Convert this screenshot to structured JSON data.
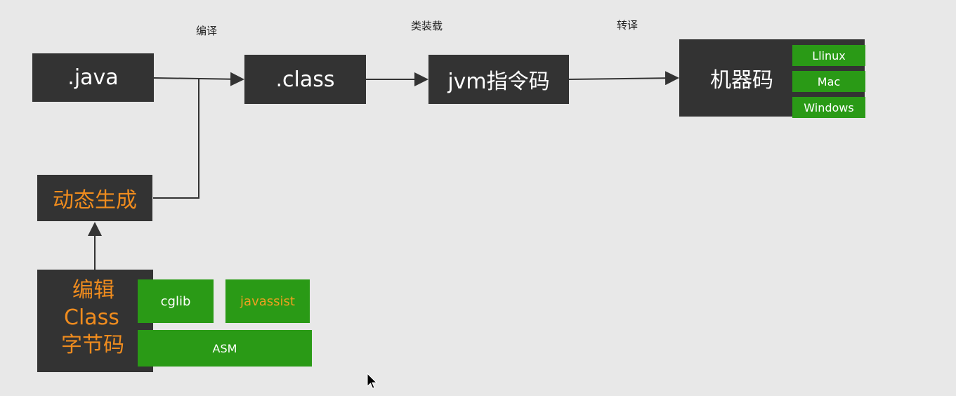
{
  "edges": {
    "compile": "编译",
    "class_loading": "类装载",
    "translate": "转译"
  },
  "nodes": {
    "java": ".java",
    "class": ".class",
    "jvm": "jvm指令码",
    "machine": "机器码",
    "dynamic": "动态生成",
    "edit_line1": "编辑",
    "edit_line2": "Class",
    "edit_line3": "字节码"
  },
  "platforms": [
    "Llinux",
    "Mac",
    "Windows"
  ],
  "libraries": {
    "cglib": "cglib",
    "javassist": "javassist",
    "asm": "ASM"
  },
  "colors": {
    "box": "#333333",
    "green": "#2a9a16",
    "orange": "#f08c1e",
    "background": "#e8e8e8"
  }
}
